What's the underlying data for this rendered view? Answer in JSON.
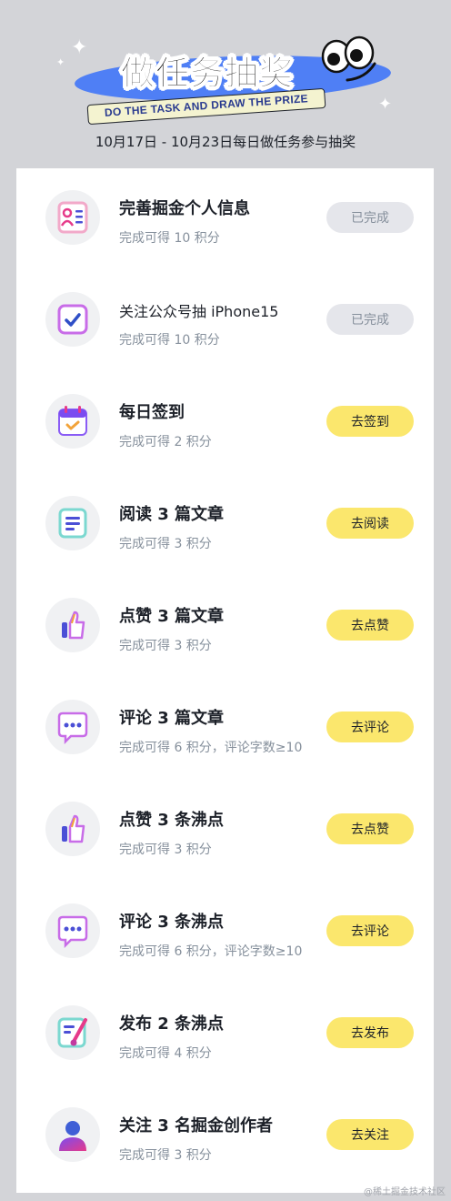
{
  "banner": {
    "headline": "做任务抽奖",
    "ribbon": "DO THE TASK AND DRAW THE PRIZE",
    "period": "10月17日 - 10月23日每日做任务参与抽奖"
  },
  "colors": {
    "page_bg": "#d3d4d8",
    "card_bg": "#ffffff",
    "action_button": "#fbe76d",
    "done_button": "#e5e6eb",
    "banner_blob": "#4f7ff5"
  },
  "tasks": [
    {
      "title": "完善掘金个人信息",
      "desc": "完成可得 10 积分",
      "button": "已完成",
      "done": true,
      "icon": "profile-card-icon"
    },
    {
      "title": "关注公众号抽 iPhone15",
      "desc": "完成可得 10 积分",
      "button": "已完成",
      "done": true,
      "icon": "checkbox-icon"
    },
    {
      "title": "每日签到",
      "desc": "完成可得 2 积分",
      "button": "去签到",
      "done": false,
      "icon": "calendar-check-icon"
    },
    {
      "title": "阅读 3 篇文章",
      "desc": "完成可得 3 积分",
      "button": "去阅读",
      "done": false,
      "icon": "article-icon"
    },
    {
      "title": "点赞 3 篇文章",
      "desc": "完成可得 3 积分",
      "button": "去点赞",
      "done": false,
      "icon": "thumbs-up-icon"
    },
    {
      "title": "评论 3 篇文章",
      "desc": "完成可得 6 积分，评论字数≥10",
      "button": "去评论",
      "done": false,
      "icon": "comment-icon"
    },
    {
      "title": "点赞 3 条沸点",
      "desc": "完成可得 3 积分",
      "button": "去点赞",
      "done": false,
      "icon": "thumbs-up-icon"
    },
    {
      "title": "评论 3 条沸点",
      "desc": "完成可得 6 积分，评论字数≥10",
      "button": "去评论",
      "done": false,
      "icon": "comment-icon"
    },
    {
      "title": "发布 2 条沸点",
      "desc": "完成可得 4 积分",
      "button": "去发布",
      "done": false,
      "icon": "edit-post-icon"
    },
    {
      "title": "关注 3 名掘金创作者",
      "desc": "完成可得 3 积分",
      "button": "去关注",
      "done": false,
      "icon": "user-follow-icon"
    }
  ],
  "watermark": "@稀土掘金技术社区"
}
